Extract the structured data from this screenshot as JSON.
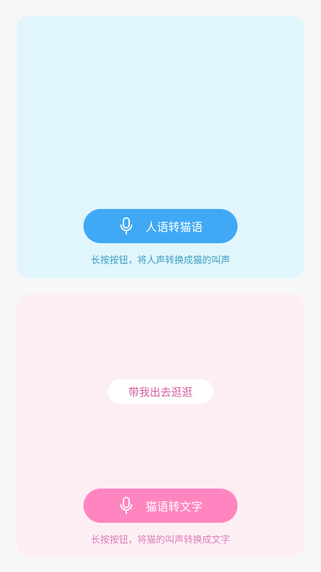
{
  "human_to_cat": {
    "button_label": "人语转猫语",
    "hint": "长按按钮，将人声转换成猫的叫声",
    "icon": "microphone-icon",
    "accent": "#3fa9f5",
    "panel_color": "#e1f5fd"
  },
  "cat_to_text": {
    "phrase": "带我出去逛逛",
    "button_label": "猫语转文字",
    "hint": "长按按钮，将猫的叫声转换成文字",
    "icon": "microphone-icon",
    "accent": "#ff85c0",
    "panel_color": "#fdeef4"
  }
}
